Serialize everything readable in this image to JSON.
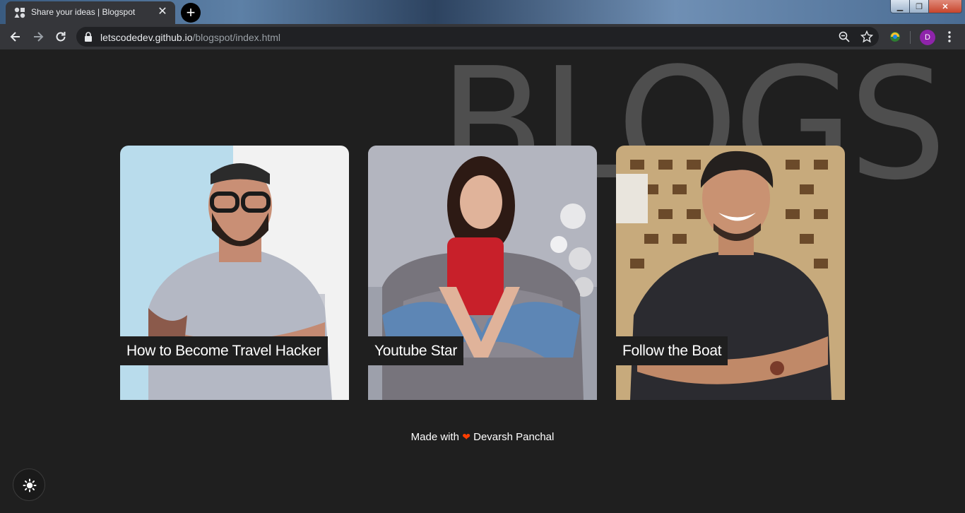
{
  "browser": {
    "tab_title": "Share your ideas | Blogspot",
    "tab_close": "✕",
    "new_tab": "+",
    "url_host": "letscodedev.github.io",
    "url_path": "/blogspot/index.html",
    "profile_initial": "D",
    "window_controls": {
      "minimize": "▁",
      "maximize": "❐",
      "close": "✕"
    }
  },
  "page": {
    "background_title": "BLOGS",
    "cards": [
      {
        "title": "How to Become Travel Hacker",
        "image": "bearded-man-photo"
      },
      {
        "title": "Youtube Star",
        "image": "woman-on-armchair-photo"
      },
      {
        "title": "Follow the Boat",
        "image": "smiling-man-photo"
      }
    ],
    "footer": {
      "prefix": "Made with",
      "heart": "❤",
      "author": "Devarsh Panchal"
    }
  },
  "colors": {
    "page_background": "#1f1f1f",
    "heart": "#ff3d00",
    "background_title": "#4e4e4e",
    "avatar": "#8e24aa"
  }
}
